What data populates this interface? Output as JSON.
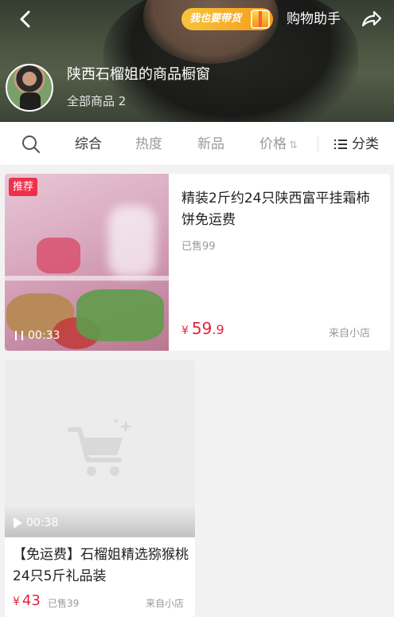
{
  "header": {
    "promo_badge": "我也要带货",
    "helper_label": "购物助手",
    "store_name": "陕西石榴姐的商品橱窗",
    "store_count": "全部商品 2"
  },
  "filters": {
    "tabs": [
      {
        "label": "综合",
        "active": true
      },
      {
        "label": "热度",
        "active": false
      },
      {
        "label": "新品",
        "active": false
      },
      {
        "label": "价格",
        "active": false
      }
    ],
    "category_label": "分类"
  },
  "products": [
    {
      "tag": "推荐",
      "video_duration": "00:33",
      "title": "精装2斤约24只陕西富平挂霜柿饼免运费",
      "sold": "已售99",
      "price_currency": "¥",
      "price_int": "59",
      "price_dec": ".9",
      "source": "来自小店"
    },
    {
      "video_duration": "00:38",
      "title": "【免运费】石榴姐精选猕猴桃24只5斤礼品装",
      "sold": "已售39",
      "price_currency": "¥",
      "price_int": "43",
      "source": "来自小店"
    }
  ],
  "colors": {
    "price": "#e3243b",
    "tag_bg": "#f0304a",
    "badge_bg": "#f7c33a"
  },
  "icons": [
    "back-arrow-icon",
    "gift-icon",
    "share-icon",
    "search-icon",
    "sort-arrows-icon",
    "list-icon",
    "pause-icon",
    "play-icon",
    "cart-icon"
  ]
}
